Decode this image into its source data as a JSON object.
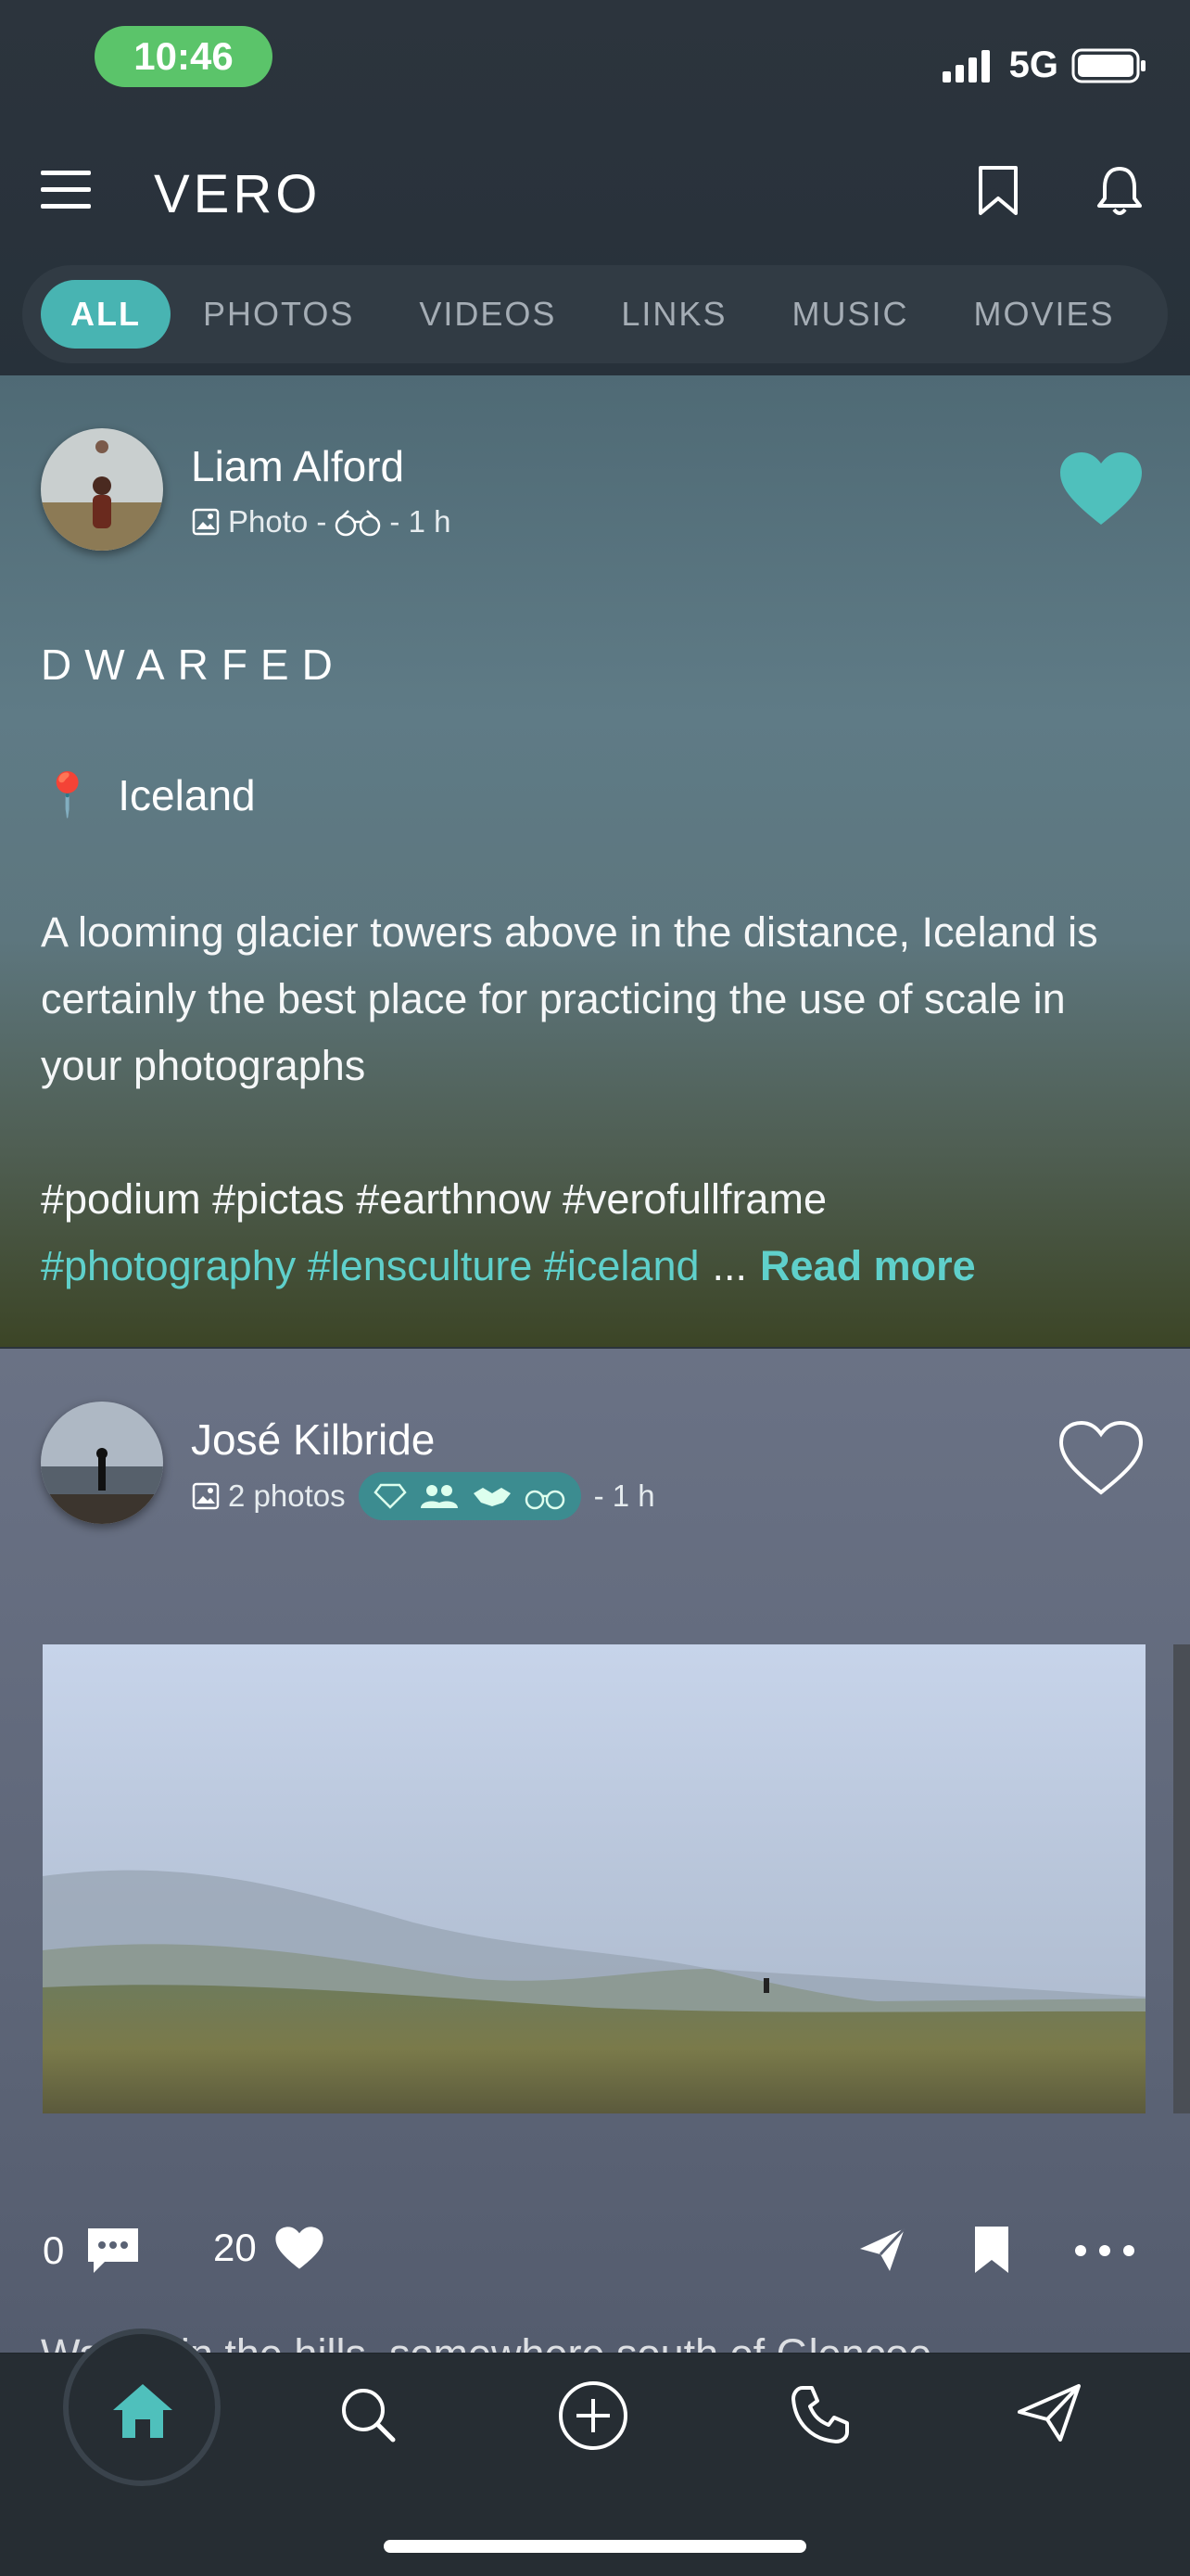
{
  "status": {
    "time": "10:46",
    "network": "5G"
  },
  "app": {
    "logo": "VERO"
  },
  "tabs": [
    "ALL",
    "PHOTOS",
    "VIDEOS",
    "LINKS",
    "MUSIC",
    "MOVIES"
  ],
  "post1": {
    "author": "Liam Alford",
    "type_label": "Photo -",
    "time": "- 1 h",
    "title": "DWARFED",
    "location_pin": "📍",
    "location": "Iceland",
    "text": "A looming glacier towers above in the distance, Iceland is certainly the best place for practicing the use of scale in your photographs",
    "hashtags_line1": "#podium #pictas #earthnow #verofullframe",
    "hashtags_line2": "#photography #lensculture #iceland",
    "ellipsis": "...",
    "read_more": "Read more",
    "accent_color": "#5fd0cb"
  },
  "post2": {
    "author": "José Kilbride",
    "type_label": "2 photos",
    "time": "- 1 h",
    "comments": "0",
    "likes": "20",
    "caption_partial": "Walker in the hills, somewhere south of Glencoe"
  },
  "icons": {
    "menu": "hamburger-icon",
    "bookmark": "bookmark-icon",
    "bell": "bell-icon",
    "home": "home-icon",
    "search": "search-icon",
    "add": "plus-circle-icon",
    "phone": "phone-icon",
    "send": "send-icon"
  }
}
